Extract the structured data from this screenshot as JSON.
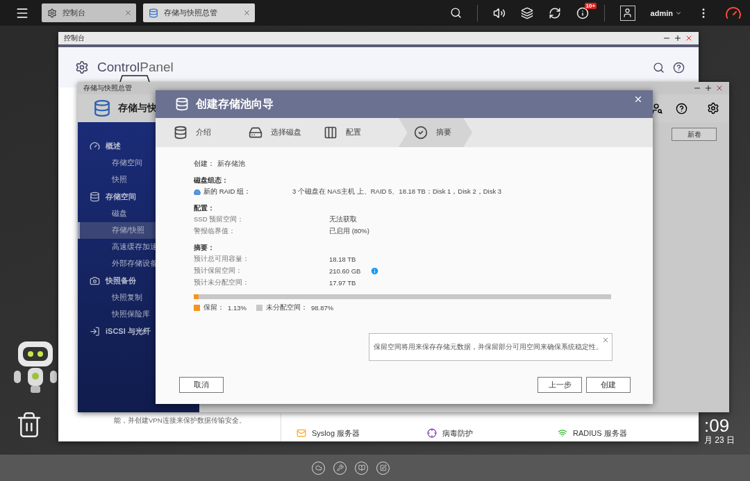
{
  "taskbar": {
    "tabs": [
      {
        "label": "控制台",
        "selected": false
      },
      {
        "label": "存储与快照总管",
        "selected": true
      }
    ],
    "badge": "10+",
    "user": "admin"
  },
  "desktop": {
    "clock": ":09",
    "date": "月 23 日"
  },
  "control_panel": {
    "title": "控制台",
    "brand_bold": "Control",
    "brand_light": "Panel",
    "note": "能，并创建VPN连接来保护数据传输安全。",
    "services": [
      {
        "label": "Syslog 服务器",
        "kind": "syslog"
      },
      {
        "label": "病毒防护",
        "kind": "antivirus"
      },
      {
        "label": "RADIUS 服务器",
        "kind": "radius"
      }
    ]
  },
  "storage_window": {
    "title": "存储与快照总管",
    "app_title": "存储与快",
    "button": "新卷",
    "nav": [
      {
        "label": "概述",
        "kind": "overview",
        "selected": false,
        "children": [
          {
            "label": "存储空间",
            "selected": false
          },
          {
            "label": "快照",
            "selected": false
          }
        ]
      },
      {
        "label": "存储空间",
        "kind": "storage",
        "selected": false,
        "children": [
          {
            "label": "磁盘",
            "selected": false
          },
          {
            "label": "存储/快照",
            "selected": true
          },
          {
            "label": "高速缓存加速",
            "selected": false
          },
          {
            "label": "外部存储设备",
            "selected": false
          }
        ]
      },
      {
        "label": "快照备份",
        "kind": "snapshot",
        "selected": false,
        "children": [
          {
            "label": "快照复制",
            "selected": false
          },
          {
            "label": "快照保险库",
            "selected": false
          }
        ]
      },
      {
        "label": "iSCSI 与光纤",
        "kind": "iscsi",
        "selected": false
      }
    ]
  },
  "wizard": {
    "title": "创建存储池向导",
    "steps": [
      {
        "label": "介绍",
        "kind": "intro",
        "selected": false
      },
      {
        "label": "选择磁盘",
        "kind": "disks",
        "selected": false
      },
      {
        "label": "配置",
        "kind": "config",
        "selected": false
      },
      {
        "label": "摘要",
        "kind": "summary",
        "selected": true
      }
    ],
    "create": {
      "label": "创建：",
      "value": "新存储池"
    },
    "groups": [
      {
        "heading": "磁盘组态：",
        "rows": [
          {
            "kind": "disk",
            "label": "新的 RAID 组：",
            "value": "3 个磁盘在 NAS主机 上、RAID 5、18.18 TB：Disk 1，Disk 2，Disk 3"
          }
        ]
      },
      {
        "heading": "配置：",
        "rows": [
          {
            "kind": "plain",
            "label": "SSD 预留空间：",
            "value": "无法获取"
          },
          {
            "kind": "plain",
            "label": "警报临界值：",
            "value": "已启用 (80%)"
          }
        ]
      },
      {
        "heading": "摘要：",
        "rows": [
          {
            "kind": "plain",
            "label": "预计总可用容量：",
            "value": "18.18 TB"
          },
          {
            "kind": "info",
            "label": "预计保留空间：",
            "value": "210.60 GB"
          },
          {
            "kind": "plain",
            "label": "预计未分配空间：",
            "value": "17.97 TB"
          }
        ]
      }
    ],
    "usage_bar": {
      "level": 0.0113
    },
    "legend": [
      {
        "label": "保留：",
        "value": "1.13%",
        "color": "#f7931e"
      },
      {
        "label": "未分配空间：",
        "value": "98.87%",
        "color": "#c8c8c8"
      }
    ],
    "buttons": {
      "cancel": "取消",
      "back": "上一步",
      "create": "创建"
    },
    "tooltip": "保留空间将用来保存存储元数据，并保留部分可用空间来确保系统稳定性。"
  }
}
